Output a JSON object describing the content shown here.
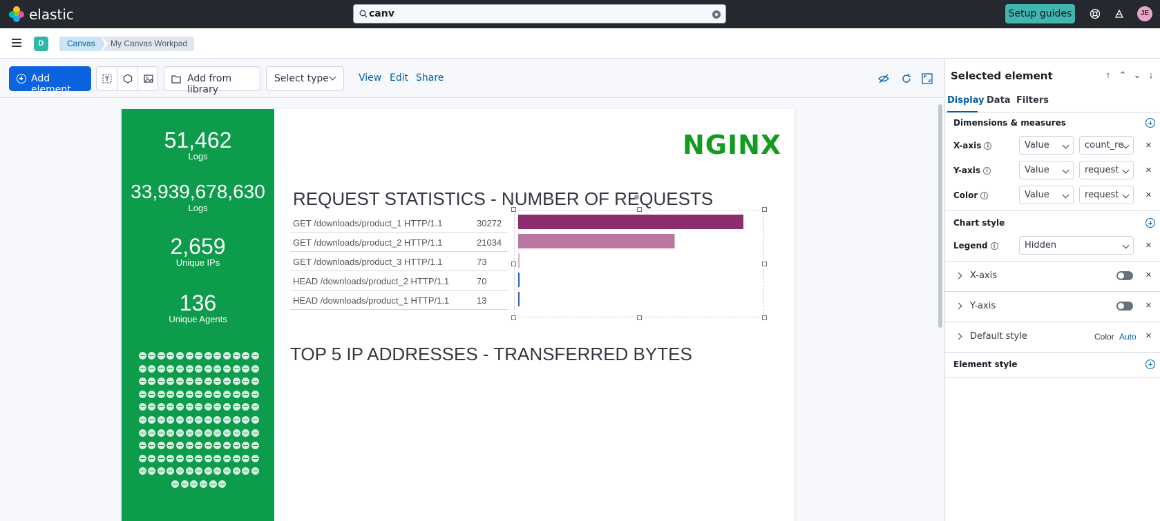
{
  "header": {
    "brand": "elastic",
    "search_value": "canv",
    "setup_guides_label": "Setup guides",
    "avatar_initials": "JE"
  },
  "breadcrumbs": {
    "space_badge": "D",
    "items": [
      "Canvas",
      "My Canvas Workpad"
    ]
  },
  "toolbar": {
    "add_element_label": "Add element",
    "add_from_library_label": "Add from library",
    "select_type_label": "Select type",
    "view_label": "View",
    "edit_label": "Edit",
    "share_label": "Share"
  },
  "workpad": {
    "stats": [
      {
        "value": "51,462",
        "label": "Logs"
      },
      {
        "value": "33,939,678,630",
        "label": "Logs"
      },
      {
        "value": "2,659",
        "label": "Unique IPs"
      },
      {
        "value": "136",
        "label": "Unique Agents"
      }
    ],
    "logo_text": "NGINX",
    "request_title": "REQUEST STATISTICS - NUMBER OF REQUESTS",
    "ip_title": "TOP 5 IP ADDRESSES - TRANSFERRED BYTES",
    "requests": [
      {
        "request": "GET /downloads/product_1 HTTP/1.1",
        "count": "30272"
      },
      {
        "request": "GET /downloads/product_2 HTTP/1.1",
        "count": "21034"
      },
      {
        "request": "GET /downloads/product_3 HTTP/1.1",
        "count": "73"
      },
      {
        "request": "HEAD /downloads/product_2 HTTP/1.1",
        "count": "70"
      },
      {
        "request": "HEAD /downloads/product_1 HTTP/1.1",
        "count": "13"
      }
    ],
    "bar_colors": [
      "#8c2d6f",
      "#b9789f",
      "#d9b0c7",
      "#2f63a8",
      "#2f63a8"
    ]
  },
  "chart_data": {
    "type": "bar",
    "orientation": "horizontal",
    "categories": [
      "GET /downloads/product_1 HTTP/1.1",
      "GET /downloads/product_2 HTTP/1.1",
      "GET /downloads/product_3 HTTP/1.1",
      "HEAD /downloads/product_2 HTTP/1.1",
      "HEAD /downloads/product_1 HTTP/1.1"
    ],
    "values": [
      30272,
      21034,
      73,
      70,
      13
    ],
    "title": "REQUEST STATISTICS - NUMBER OF REQUESTS",
    "xlabel": "",
    "ylabel": "",
    "xlim": [
      0,
      30272
    ],
    "grid": false,
    "legend": "hidden"
  },
  "panel": {
    "title": "Selected element",
    "tabs": [
      "Display",
      "Data",
      "Filters"
    ],
    "dimensions_title": "Dimensions & measures",
    "rows": [
      {
        "label": "X-axis",
        "kind": "Value",
        "field": "count_re"
      },
      {
        "label": "Y-axis",
        "kind": "Value",
        "field": "request"
      },
      {
        "label": "Color",
        "kind": "Value",
        "field": "request"
      }
    ],
    "chart_style_title": "Chart style",
    "legend_label": "Legend",
    "legend_value": "Hidden",
    "x_axis_label": "X-axis",
    "y_axis_label": "Y-axis",
    "default_style_label": "Default style",
    "color_label": "Color",
    "color_value": "Auto",
    "element_style_title": "Element style"
  }
}
